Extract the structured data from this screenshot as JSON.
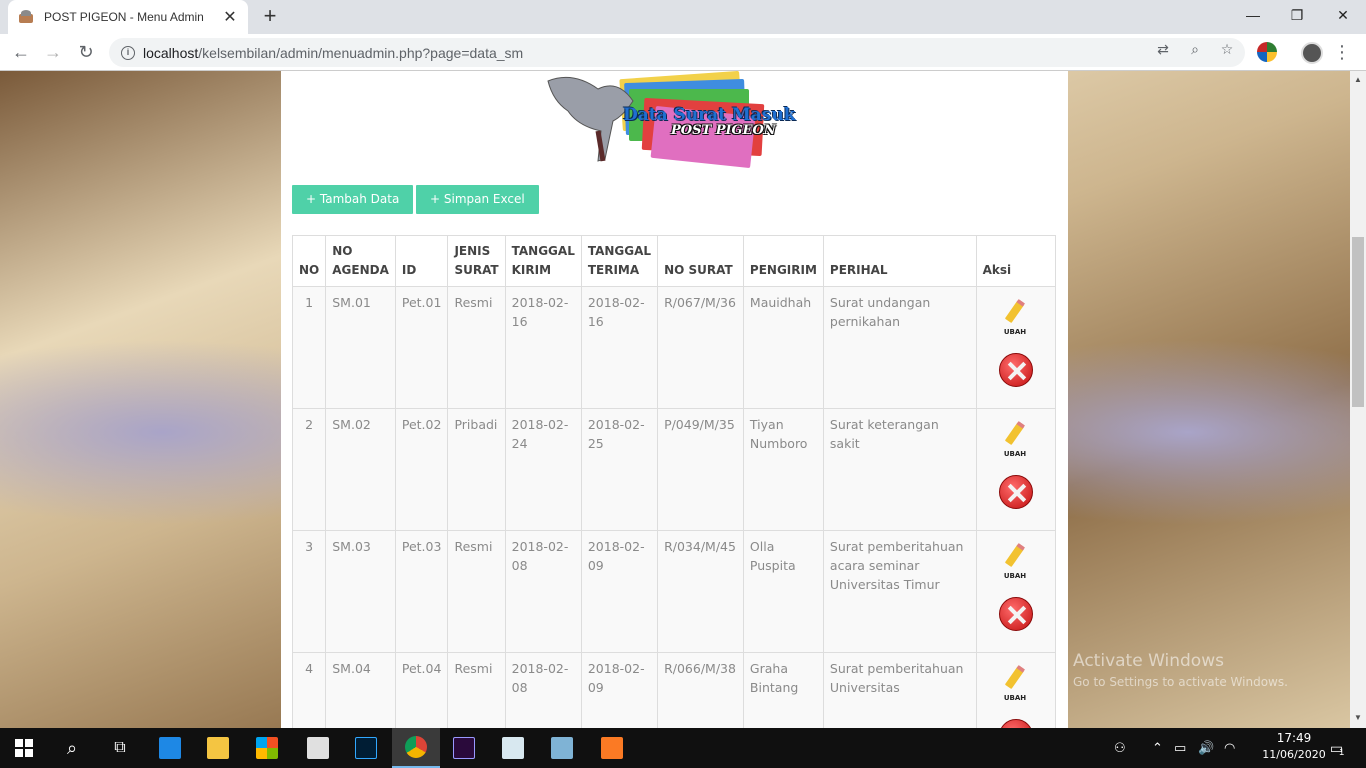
{
  "browser": {
    "tab_title": "POST PIGEON - Menu Admin",
    "url_host": "localhost",
    "url_path": "/kelsembilan/admin/menuadmin.php?page=data_sm"
  },
  "logo": {
    "title": "Data Surat Masuk",
    "subtitle": "POST PIGEON"
  },
  "actions": {
    "add_label": "+ Tambah Data",
    "excel_label": "+ Simpan Excel"
  },
  "table": {
    "headers": {
      "no": "NO",
      "agenda_1": "NO",
      "agenda_2": "AGENDA",
      "id": "ID",
      "jenis_1": "JENIS",
      "jenis_2": "SURAT",
      "kirim_1": "TANGGAL",
      "kirim_2": "KIRIM",
      "terima_1": "TANGGAL",
      "terima_2": "TERIMA",
      "nosurat": "NO SURAT",
      "pengirim": "PENGIRIM",
      "perihal": "PERIHAL",
      "aksi": "Aksi"
    },
    "rows": [
      {
        "no": "1",
        "agenda": "SM.01",
        "id": "Pet.01",
        "jenis": "Resmi",
        "kirim_a": "2018-02-",
        "kirim_b": "16",
        "terima_a": "2018-02-",
        "terima_b": "16",
        "nosurat": "R/067/M/36",
        "pengirim": "Mauidhah",
        "perihal": "Surat undangan pernikahan"
      },
      {
        "no": "2",
        "agenda": "SM.02",
        "id": "Pet.02",
        "jenis": "Pribadi",
        "kirim_a": "2018-02-",
        "kirim_b": "24",
        "terima_a": "2018-02-",
        "terima_b": "25",
        "nosurat": "P/049/M/35",
        "pengirim": "Tiyan Numboro",
        "perihal": "Surat keterangan sakit"
      },
      {
        "no": "3",
        "agenda": "SM.03",
        "id": "Pet.03",
        "jenis": "Resmi",
        "kirim_a": "2018-02-",
        "kirim_b": "08",
        "terima_a": "2018-02-",
        "terima_b": "09",
        "nosurat": "R/034/M/45",
        "pengirim": "Olla Puspita",
        "perihal": "Surat pemberitahuan acara seminar Universitas Timur"
      },
      {
        "no": "4",
        "agenda": "SM.04",
        "id": "Pet.04",
        "jenis": "Resmi",
        "kirim_a": "2018-02-",
        "kirim_b": "08",
        "terima_a": "2018-02-",
        "terima_b": "09",
        "nosurat": "R/066/M/38",
        "pengirim": "Graha Bintang",
        "perihal": "Surat pemberitahuan Universitas"
      }
    ],
    "ubah_label": "UBAH"
  },
  "watermark": {
    "line1": "Activate Windows",
    "line2": "Go to Settings to activate Windows."
  },
  "taskbar": {
    "time": "17:49",
    "date": "11/06/2020",
    "notif_count": "1"
  }
}
